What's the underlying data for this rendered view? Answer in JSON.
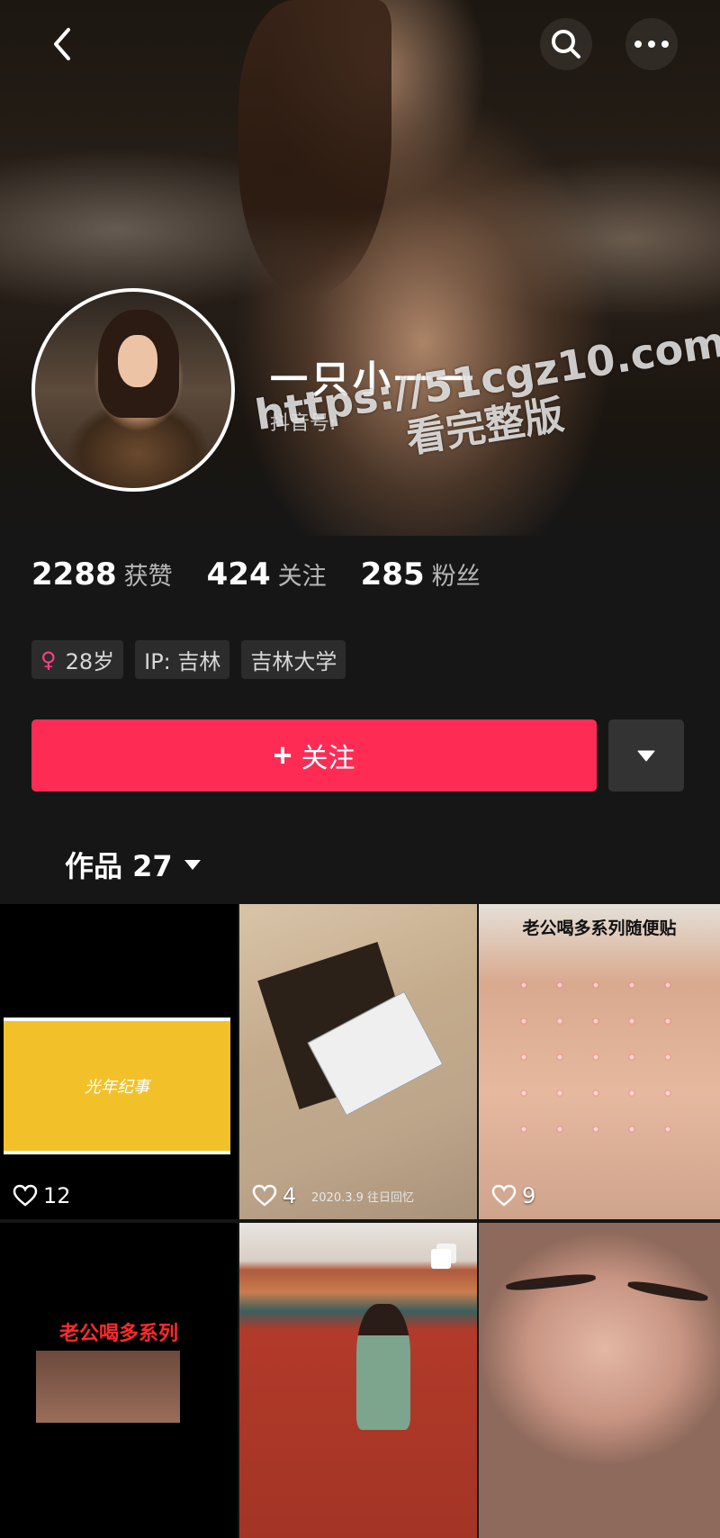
{
  "header": {
    "back_icon": "chevron-left-icon",
    "search_icon": "search-icon",
    "more_icon": "more-horizontal-icon"
  },
  "profile": {
    "name": "一只小一一",
    "douyin_id_label": "抖音号:",
    "watermark_url": "https://51cgz10.com",
    "watermark_text": "看完整版"
  },
  "stats": [
    {
      "value": "2288",
      "label": "获赞"
    },
    {
      "value": "424",
      "label": "关注"
    },
    {
      "value": "285",
      "label": "粉丝"
    }
  ],
  "tags": {
    "age": "28岁",
    "ip": "IP:  吉林",
    "school": "吉林大学",
    "gender_icon": "female-icon",
    "gender_color": "#ff3f82"
  },
  "actions": {
    "follow_label": "关注",
    "follow_color": "#fe2c55",
    "dropdown_icon": "caret-down-icon"
  },
  "works": {
    "tab_label": "作品 27"
  },
  "videos": [
    {
      "likes": "12",
      "overlay_text": "光年纪事"
    },
    {
      "likes": "4",
      "date": "2020.3.9 往日回忆"
    },
    {
      "likes": "9",
      "caption": "老公喝多系列随便贴"
    },
    {
      "caption": "老公喝多系列"
    },
    {
      "multi_icon": "multi-image-icon"
    },
    {}
  ]
}
